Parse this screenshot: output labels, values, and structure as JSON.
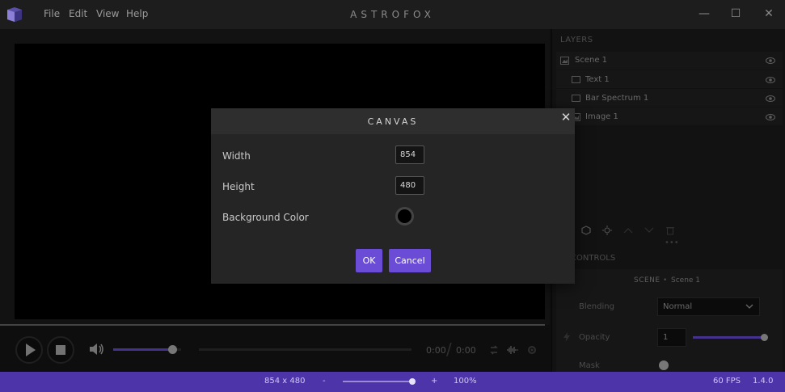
{
  "app": {
    "title": "ASTROFOX",
    "menu": [
      "File",
      "Edit",
      "View",
      "Help"
    ],
    "window_controls": {
      "minimize": "—",
      "maximize": "☐",
      "close": "✕"
    }
  },
  "player": {
    "current_time": "0:00",
    "time_separator": "/",
    "total_time": "0:00",
    "volume_fraction": 0.87
  },
  "layers": {
    "title": "LAYERS",
    "items": [
      {
        "label": "Scene 1",
        "icon": "image-icon"
      },
      {
        "label": "Text 1",
        "icon": "rectangle-icon"
      },
      {
        "label": "Bar Spectrum 1",
        "icon": "rectangle-icon"
      },
      {
        "label": "Image 1",
        "icon": "image-icon"
      }
    ]
  },
  "controls": {
    "title": "CONTROLS",
    "scene_header": "SCENE",
    "scene_name": "Scene 1",
    "blending_label": "Blending",
    "blending_value": "Normal",
    "opacity_label": "Opacity",
    "opacity_value": "1",
    "mask_label": "Mask"
  },
  "statusbar": {
    "dimensions": "854 x 480",
    "zoom_minus": "-",
    "zoom_plus": "+",
    "zoom_value": "100%",
    "fps": "60 FPS",
    "version": "1.4.0"
  },
  "dialog": {
    "title": "CANVAS",
    "width_label": "Width",
    "width_value": "854",
    "height_label": "Height",
    "height_value": "480",
    "bg_color_label": "Background Color",
    "bg_color_value": "#000000",
    "ok_label": "OK",
    "cancel_label": "Cancel",
    "close_label": "✕"
  },
  "colors": {
    "accent": "#6a4cd6",
    "statusbar": "#4d34a8"
  }
}
